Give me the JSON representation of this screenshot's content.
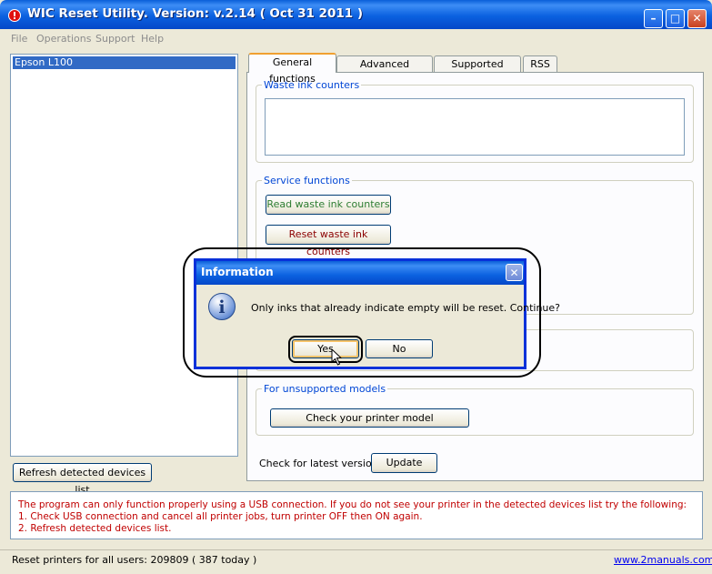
{
  "window": {
    "title": "WIC Reset Utility. Version: v.2.14 ( Oct 31 2011 )",
    "icon": "!"
  },
  "menu": [
    "File",
    "Operations",
    "Support",
    "Help"
  ],
  "devices": {
    "items": [
      "Epson L100"
    ],
    "refresh_label": "Refresh detected devices list"
  },
  "tabs": [
    "General functions",
    "Advanced functions",
    "Supported models",
    "RSS"
  ],
  "general": {
    "waste_title": "Waste ink counters",
    "service_title": "Service functions",
    "read_label": "Read waste ink counters",
    "reset_label": "Reset waste ink counters",
    "unsupported_title": "For unsupported models",
    "check_model_label": "Check your printer model",
    "latest_version_label": "Check for latest version",
    "update_label": "Update"
  },
  "status_message": {
    "line1": "The program can only function properly using a USB connection. If you do not see your printer in the detected devices list try the following:",
    "line2": "1. Check USB connection and cancel all printer jobs, turn printer OFF then ON again.",
    "line3": "2. Refresh detected devices list."
  },
  "statusbar": {
    "text": "Reset printers for all users: 209809 ( 387 today )",
    "link": "www.2manuals.com"
  },
  "dialog": {
    "title": "Information",
    "message": "Only inks that already indicate empty will be reset. Continue?",
    "yes_label": "Yes",
    "no_label": "No",
    "icon": "i"
  },
  "colors": {
    "titlebar": "#0a5fd8",
    "accent_tab": "#f0a030",
    "read_button_text": "#2e7d32",
    "reset_button_text": "#8b0000",
    "status_text": "#c00000"
  }
}
